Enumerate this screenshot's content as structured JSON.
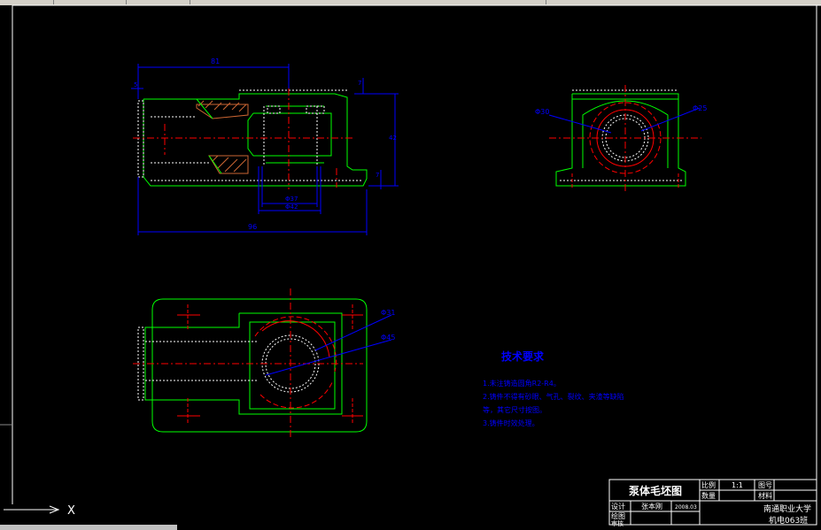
{
  "window": {
    "title": ""
  },
  "drawing": {
    "front_view": {
      "dims": {
        "top_length": "81",
        "overall_length": "96",
        "inner_bore_1": "Φ37",
        "inner_bore_2": "Φ42",
        "height": "42",
        "small_left": "5",
        "right_top": "7",
        "right_bottom": "7"
      }
    },
    "side_view": {
      "dia_left": "Φ30",
      "dia_right": "Φ25"
    },
    "top_view": {
      "dia_top": "Φ31",
      "dia_bottom": "Φ45"
    },
    "technical_requirements": {
      "title": "技术要求",
      "items": [
        "1.未注铸造圆角R2-R4。",
        "2.铸件不得有砂眼、气孔、裂纹、夹渣等缺陷",
        "等，其它尺寸按图。",
        "3.铸件时效处理。"
      ]
    },
    "title_block": {
      "title": "泵体毛坯图",
      "scale_label": "比例",
      "scale_value": "1:1",
      "quantity_label": "数量",
      "drawing_no_label": "图号",
      "material_label": "材料",
      "designer_label": "设计",
      "designer_name": "张本刚",
      "date": "2008.03",
      "drafter_label": "绘图",
      "reviewer_label": "审核",
      "school": "南通职业大学",
      "class": "机电063班"
    }
  },
  "ucs": {
    "x_label": "X"
  },
  "colors": {
    "background": "#000000",
    "outline": "#00ff00",
    "hidden": "#ffffff",
    "center": "#ff0000",
    "dimension": "#0000ff",
    "hatch": "#cc6633",
    "frame": "#ffffff"
  }
}
